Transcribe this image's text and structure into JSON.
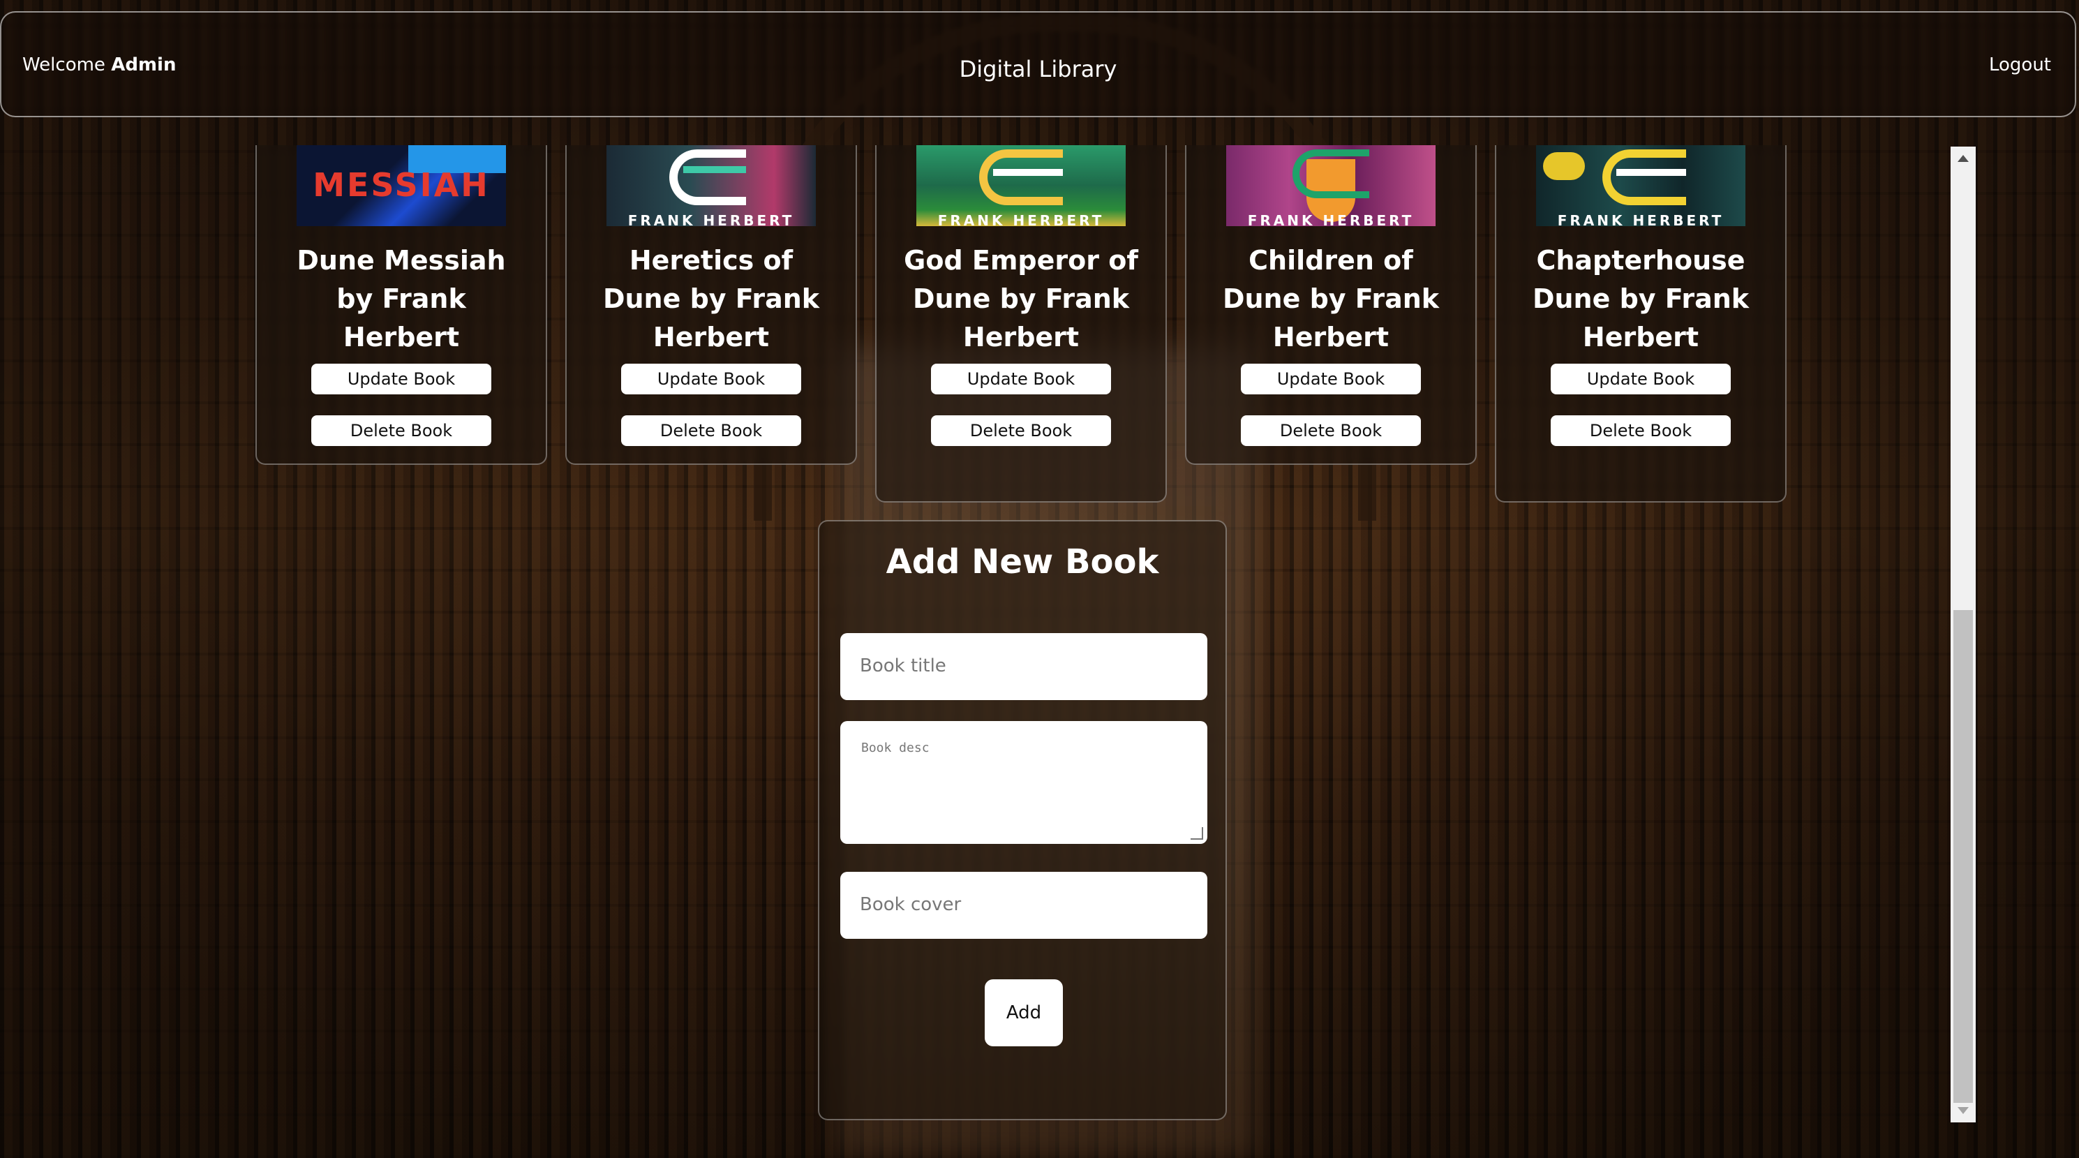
{
  "header": {
    "welcome_prefix": "Welcome",
    "welcome_user": "Admin",
    "app_title": "Digital Library",
    "logout_label": "Logout"
  },
  "books": [
    {
      "title": "Dune Messiah by Frank Herbert",
      "cover_text": "MESSIAH",
      "cover_bg": "#0f1a3a",
      "cover_accent": "#e63b2e",
      "update_label": "Update Book",
      "delete_label": "Delete Book"
    },
    {
      "title": "Heretics of Dune by Frank Herbert",
      "cover_text": "FRANK HERBERT",
      "cover_bg": "#1b2a35",
      "cover_accent": "#3ec9a7",
      "update_label": "Update Book",
      "delete_label": "Delete Book"
    },
    {
      "title": "God Emperor of Dune by Frank Herbert",
      "cover_text": "FRANK HERBERT",
      "cover_bg": "#1e6a4a",
      "cover_accent": "#f4c542",
      "update_label": "Update Book",
      "delete_label": "Delete Book"
    },
    {
      "title": "Children of Dune by Frank Herbert",
      "cover_text": "FRANK HERBERT",
      "cover_bg": "#7a2a6a",
      "cover_accent": "#f29a2e",
      "update_label": "Update Book",
      "delete_label": "Delete Book"
    },
    {
      "title": "Chapterhouse Dune by Frank Herbert",
      "cover_text": "FRANK HERBERT",
      "cover_bg": "#10262a",
      "cover_accent": "#f2d232",
      "update_label": "Update Book",
      "delete_label": "Delete Book"
    }
  ],
  "add_form": {
    "title": "Add New Book",
    "title_placeholder": "Book title",
    "desc_placeholder": "Book desc",
    "cover_placeholder": "Book cover",
    "add_label": "Add"
  },
  "colors": {
    "button_bg": "#ffffff",
    "button_text": "#111111",
    "panel_border": "rgba(255,255,255,0.35)"
  }
}
